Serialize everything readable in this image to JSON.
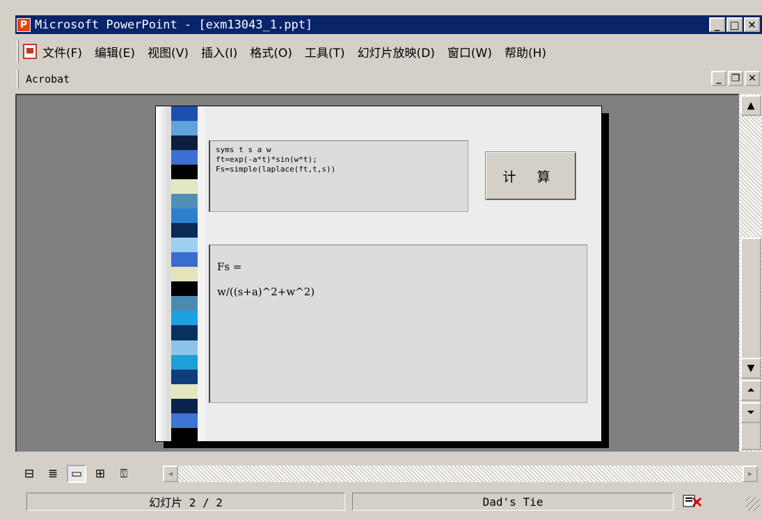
{
  "window": {
    "title": "Microsoft PowerPoint - [exm13043_1.ppt]",
    "app_icon_glyph": "P",
    "controls": {
      "minimize": "_",
      "maximize": "□",
      "close": "✕"
    }
  },
  "menubar": {
    "items": [
      "文件(F)",
      "编辑(E)",
      "视图(V)",
      "插入(I)",
      "格式(O)",
      "工具(T)",
      "幻灯片放映(D)",
      "窗口(W)",
      "帮助(H)"
    ]
  },
  "acrobat_bar": {
    "label": "Acrobat",
    "controls": {
      "minimize": "_",
      "restore": "❐",
      "close": "✕"
    }
  },
  "slide": {
    "code_lines": [
      "syms t s a w",
      "ft=exp(-a*t)*sin(w*t);",
      "Fs=simple(laplace(ft,t,s))"
    ],
    "calc_button_label": "计 算",
    "result_lines": [
      "Fs =",
      "w/((s+a)^2+w^2)"
    ],
    "tie_colors": [
      "#1c4fb0",
      "#5fa4d8",
      "#0c1f3e",
      "#3b6fd1",
      "#000000",
      "#e3e7c4",
      "#4f8fb8",
      "#2d7fd0",
      "#0a2b57",
      "#9fcff0",
      "#3a6bcf",
      "#e6e3b8",
      "#000000",
      "#4a8ab0",
      "#1fa0e0",
      "#073260",
      "#8fc4ea",
      "#1e9fd6",
      "#0d3d7a",
      "#e4e6c0",
      "#0c2350",
      "#3e74d4",
      "#000000"
    ]
  },
  "viewbar": {
    "buttons": [
      {
        "name": "normal-view",
        "glyph": "⊟"
      },
      {
        "name": "outline-view",
        "glyph": "≣"
      },
      {
        "name": "slide-view",
        "glyph": "▭"
      },
      {
        "name": "slide-sorter-view",
        "glyph": "⊞"
      },
      {
        "name": "slide-show-view",
        "glyph": "⍔"
      }
    ]
  },
  "statusbar": {
    "slide_info": "幻灯片 2 / 2",
    "design_template": "Dad's Tie"
  },
  "colors": {
    "titlebar": "#0a246a",
    "workspace": "#808080",
    "chrome": "#d4d0c8"
  }
}
